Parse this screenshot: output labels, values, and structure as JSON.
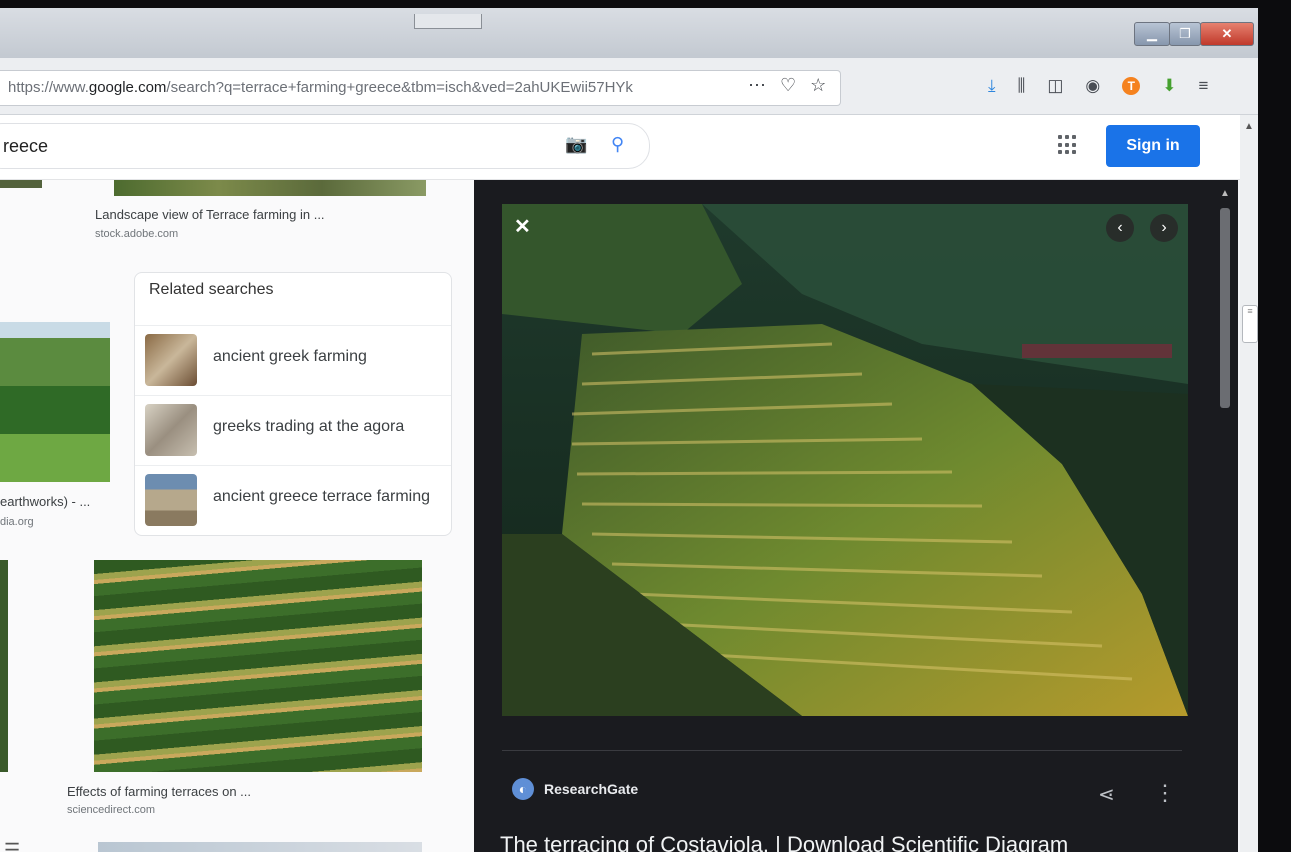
{
  "browser": {
    "url": {
      "prefix": "https://www.",
      "domain": "google.com",
      "path": "/search?q=terrace+farming+greece&tbm=isch&ved=2ahUKEwii57HYk"
    },
    "window_controls": {
      "minimize": "▁",
      "maximize": "❐",
      "close": "✕"
    }
  },
  "search": {
    "query": "reece",
    "sign_in_label": "Sign in"
  },
  "results": [
    {
      "caption": "Landscape view of Terrace farming in ...",
      "source": "stock.adobe.com"
    },
    {
      "caption": "earthworks) - ...",
      "source": "dia.org"
    },
    {
      "caption": "Effects of farming terraces on ...",
      "source": "sciencedirect.com"
    }
  ],
  "related": {
    "title": "Related searches",
    "items": [
      {
        "label": "ancient greek farming"
      },
      {
        "label": "greeks trading at the agora"
      },
      {
        "label": "ancient greece terrace farming"
      }
    ]
  },
  "panel": {
    "source_name": "ResearchGate",
    "title": "The terracing of Costaviola. | Download Scientific Diagram"
  },
  "colors": {
    "accent": "#1a73e8",
    "panel_bg": "#1a1b1f",
    "close_button": "#c0392b"
  }
}
